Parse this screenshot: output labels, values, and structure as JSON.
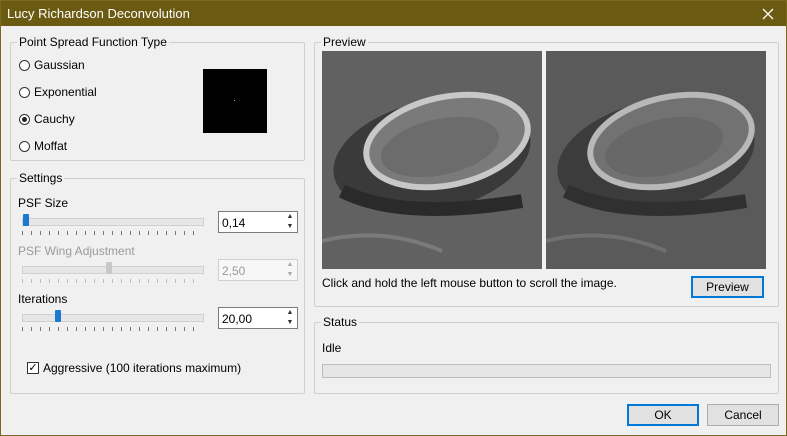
{
  "window": {
    "title": "Lucy Richardson Deconvolution"
  },
  "psf_group": {
    "legend": "Point Spread Function Type",
    "options": [
      {
        "label": "Gaussian",
        "checked": false
      },
      {
        "label": "Exponential",
        "checked": false
      },
      {
        "label": "Cauchy",
        "checked": true
      },
      {
        "label": "Moffat",
        "checked": false
      }
    ]
  },
  "settings": {
    "legend": "Settings",
    "psf_size": {
      "label": "PSF Size",
      "value": "0,14",
      "slider_fraction": 0.0
    },
    "psf_wing": {
      "label": "PSF Wing Adjustment",
      "value": "2,50",
      "slider_fraction": 0.48,
      "disabled": true
    },
    "iterations": {
      "label": "Iterations",
      "value": "20,00",
      "slider_fraction": 0.19
    },
    "aggressive": {
      "label": "Aggressive (100 iterations maximum)",
      "checked": true
    }
  },
  "preview": {
    "legend": "Preview",
    "hint": "Click and hold the left mouse button to scroll the image.",
    "button": "Preview"
  },
  "status": {
    "legend": "Status",
    "text": "Idle",
    "progress": 0
  },
  "buttons": {
    "ok": "OK",
    "cancel": "Cancel"
  }
}
